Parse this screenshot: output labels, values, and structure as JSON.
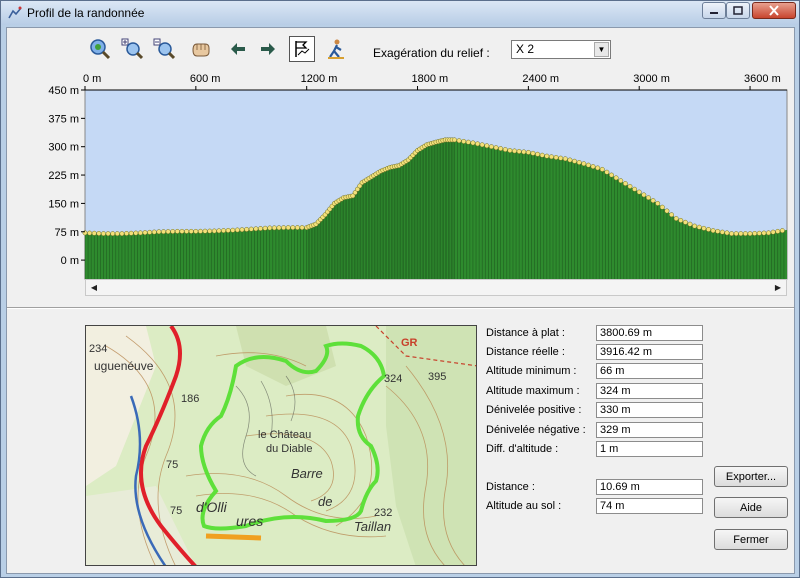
{
  "window": {
    "title": "Profil de la randonnée"
  },
  "toolbar": {
    "relief_label": "Exagération du relief :",
    "relief_value": "X 2",
    "buttons": [
      "zoom-fit-icon",
      "zoom-in-icon",
      "zoom-out-icon",
      "hand-pan-icon",
      "arrow-left-icon",
      "arrow-right-icon",
      "flag-profile-icon",
      "hiker-icon"
    ]
  },
  "chart_data": {
    "type": "area",
    "x_unit": "m",
    "y_unit": "m",
    "xlim": [
      0,
      3800
    ],
    "ylim": [
      -50,
      450
    ],
    "x_ticks": [
      "0 m",
      "600 m",
      "1200 m",
      "1800 m",
      "2400 m",
      "3000 m",
      "3600 m"
    ],
    "y_ticks": [
      "450 m",
      "375 m",
      "300 m",
      "225 m",
      "150 m",
      "75 m",
      "0 m"
    ],
    "fill_color": "#2e8b2e",
    "background_color": "#c5d9f5",
    "point_color": "#f2e07a",
    "x": [
      0,
      100,
      200,
      300,
      400,
      500,
      600,
      700,
      800,
      900,
      1000,
      1100,
      1200,
      1250,
      1300,
      1350,
      1400,
      1450,
      1500,
      1550,
      1600,
      1650,
      1700,
      1750,
      1800,
      1850,
      1900,
      1950,
      2000,
      2100,
      2200,
      2300,
      2400,
      2500,
      2600,
      2700,
      2800,
      2900,
      3000,
      3100,
      3200,
      3300,
      3400,
      3500,
      3600,
      3700,
      3800
    ],
    "y": [
      72,
      70,
      70,
      72,
      75,
      76,
      76,
      77,
      79,
      82,
      85,
      86,
      86,
      95,
      120,
      150,
      165,
      170,
      205,
      220,
      235,
      245,
      250,
      265,
      290,
      305,
      312,
      318,
      318,
      310,
      300,
      290,
      285,
      275,
      268,
      255,
      240,
      210,
      180,
      150,
      110,
      90,
      78,
      70,
      70,
      72,
      80
    ]
  },
  "map": {
    "labels": [
      "234",
      "uguenéuve",
      "186",
      "75",
      "75",
      "le Château",
      "du Diable",
      "Barre",
      "de",
      "Taillan",
      "d'Olli",
      "ures",
      "324",
      "395",
      "232",
      "GR"
    ],
    "route_color": "#5ee03a",
    "road_color": "#e0202a"
  },
  "stats": [
    {
      "label": "Distance à plat :",
      "value": "3800.69 m"
    },
    {
      "label": "Distance réelle :",
      "value": "3916.42 m"
    },
    {
      "label": "Altitude minimum :",
      "value": "66 m"
    },
    {
      "label": "Altitude maximum :",
      "value": "324 m"
    },
    {
      "label": "Dénivelée positive :",
      "value": "330 m"
    },
    {
      "label": "Dénivelée négative :",
      "value": "329 m"
    },
    {
      "label": "Diff. d'altitude :",
      "value": "1 m"
    }
  ],
  "position": [
    {
      "label": "Distance :",
      "value": "10.69 m"
    },
    {
      "label": "Altitude au sol :",
      "value": "74 m"
    }
  ],
  "buttons": {
    "export": "Exporter...",
    "help": "Aide",
    "close": "Fermer"
  }
}
